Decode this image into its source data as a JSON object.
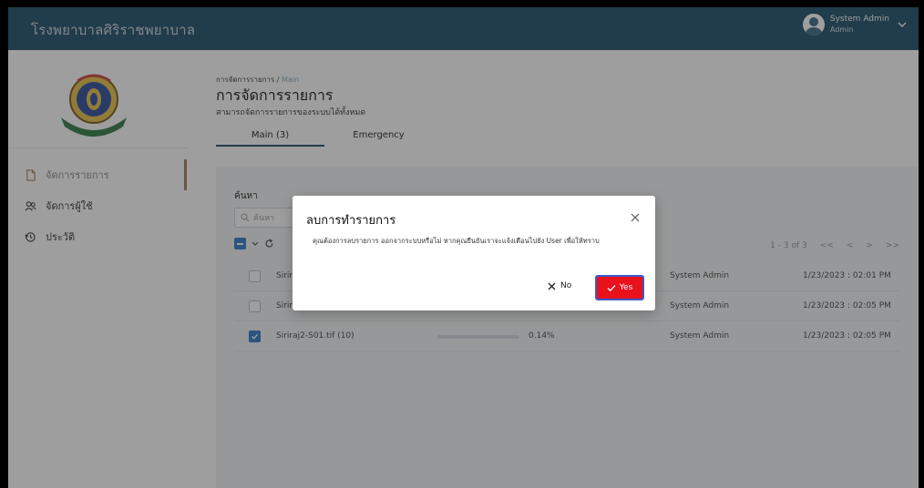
{
  "header": {
    "brand": "โรงพยาบาลศิริราชพยาบาล",
    "user_name": "System Admin",
    "user_role": "Admin"
  },
  "sidebar": {
    "items": [
      {
        "label": "จัดการรายการ",
        "icon": "file-icon",
        "active": true
      },
      {
        "label": "จัดการผู้ใช้",
        "icon": "users-icon",
        "active": false
      },
      {
        "label": "ประวัติ",
        "icon": "history-icon",
        "active": false
      }
    ]
  },
  "main": {
    "breadcrumb_parent": "การจัดการรายการ",
    "breadcrumb_separator": " / ",
    "breadcrumb_current": "Main",
    "title": "การจัดการรายการ",
    "subtitle": "สามารถจัดการรายการของระบบได้ทั้งหมด",
    "tabs": [
      {
        "label": "Main (3)",
        "active": true
      },
      {
        "label": "Emergency",
        "active": false
      }
    ],
    "search_label": "ค้นหา",
    "search_placeholder": "ค้นหา",
    "pagination": {
      "range": "1 - 3 of 3",
      "first": "<<",
      "prev": "<",
      "next": ">",
      "last": ">>"
    },
    "rows": [
      {
        "file": "Siriraj",
        "progress": null,
        "progress_text": "",
        "uploader": "System Admin",
        "date": "1/23/2023 : 02:01 PM",
        "checked": false
      },
      {
        "file": "Siriraj",
        "progress": null,
        "progress_text": "",
        "uploader": "System Admin",
        "date": "1/23/2023 : 02:05 PM",
        "checked": false
      },
      {
        "file": "Siriraj2-S01.tif (10)",
        "progress": 0.14,
        "progress_text": "0.14%",
        "uploader": "System Admin",
        "date": "1/23/2023 : 02:05 PM",
        "checked": true
      }
    ]
  },
  "modal": {
    "title": "ลบการทำรายการ",
    "message": "คุณต้องการลบรายการ ออกจากระบบหรือไม่ หากคุณยืนยันเราจะแจ้งเตือนไปยัง User เพื่อให้ทราบ",
    "no_label": "No",
    "yes_label": "Yes"
  },
  "colors": {
    "header_bg": "#1d4e66",
    "primary": "#3079c9",
    "danger": "#e8111c",
    "sidebar_active_indicator": "#a07d5a"
  }
}
